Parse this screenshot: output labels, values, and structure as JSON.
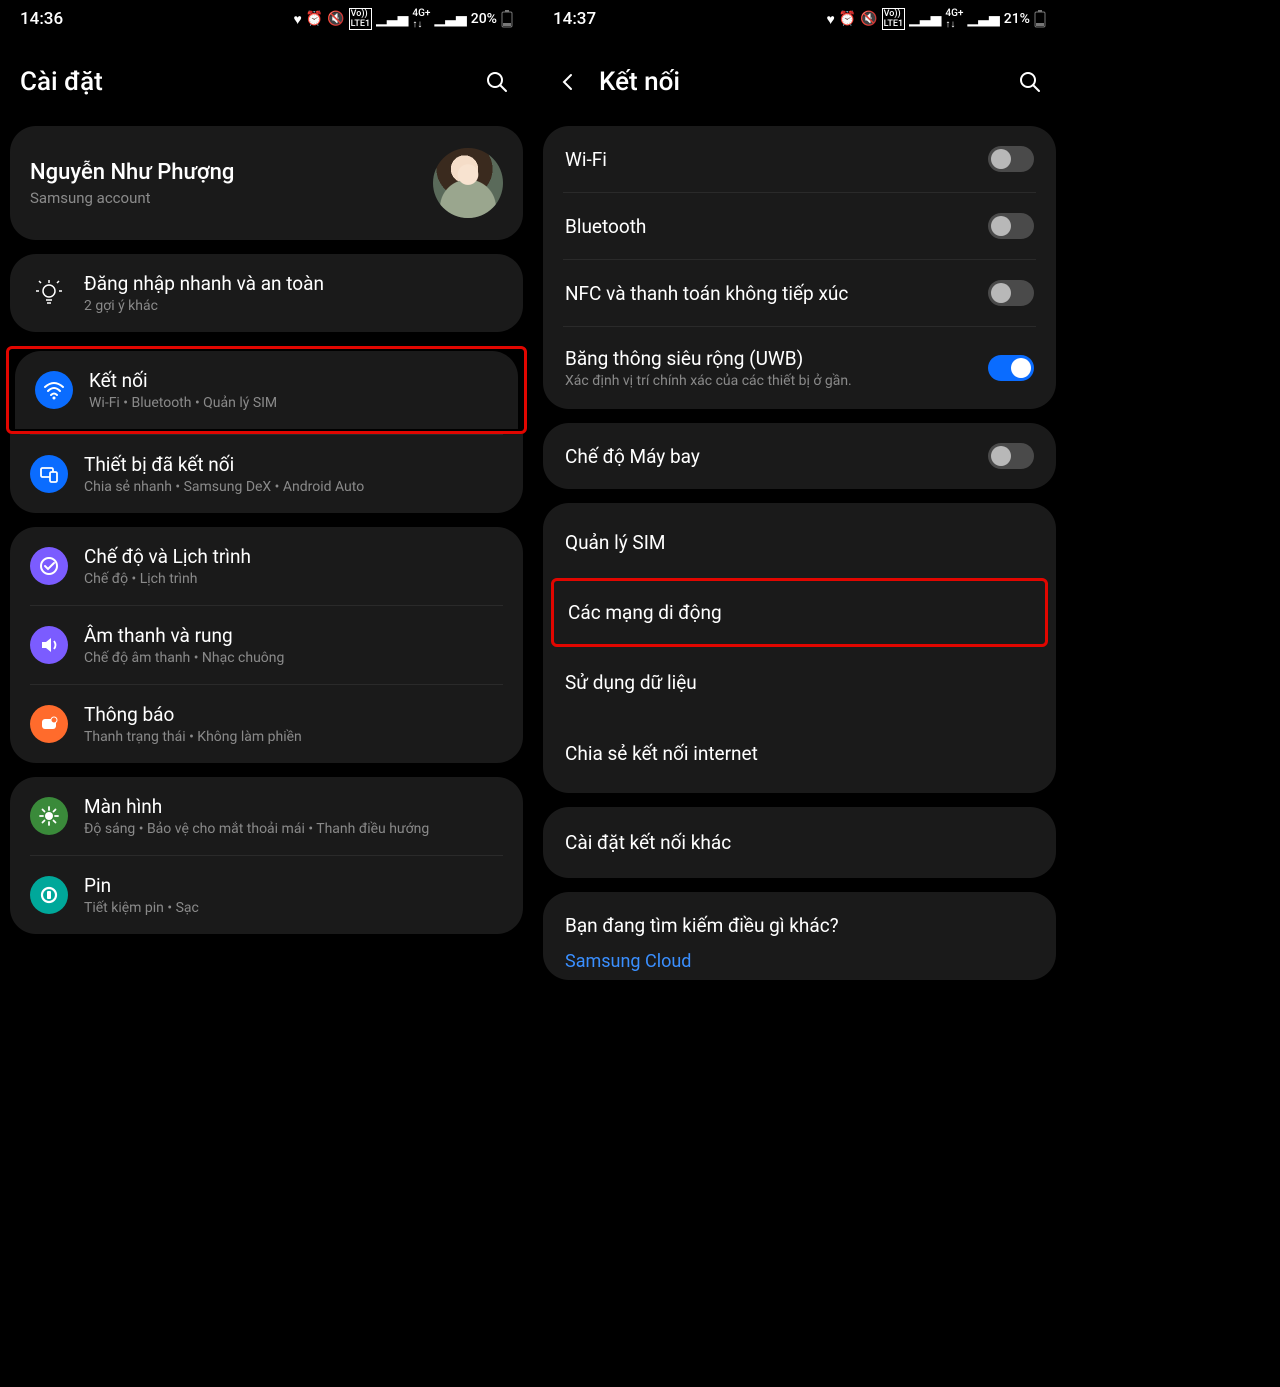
{
  "left": {
    "status": {
      "time": "14:36",
      "battery": "20%"
    },
    "title": "Cài đặt",
    "profile": {
      "name": "Nguyễn Như Phượng",
      "sub": "Samsung account"
    },
    "suggest": {
      "title": "Đăng nhập nhanh và an toàn",
      "sub": "2 gợi ý khác"
    },
    "group1": [
      {
        "title": "Kết nối",
        "sub": "Wi-Fi  •  Bluetooth  •  Quản lý SIM",
        "icon": "wifi",
        "highlight": true
      },
      {
        "title": "Thiết bị đã kết nối",
        "sub": "Chia sẻ nhanh  •  Samsung DeX  •  Android Auto",
        "icon": "devices"
      }
    ],
    "group2": [
      {
        "title": "Chế độ và Lịch trình",
        "sub": "Chế độ  •  Lịch trình",
        "icon": "modes"
      },
      {
        "title": "Âm thanh và rung",
        "sub": "Chế độ âm thanh  •  Nhạc chuông",
        "icon": "sound"
      },
      {
        "title": "Thông báo",
        "sub": "Thanh trạng thái  •  Không làm phiền",
        "icon": "notif"
      }
    ],
    "group3": [
      {
        "title": "Màn hình",
        "sub": "Độ sáng  •  Bảo vệ cho mắt thoải mái  •  Thanh điều hướng",
        "icon": "display"
      },
      {
        "title": "Pin",
        "sub": "Tiết kiệm pin  •  Sạc",
        "icon": "battery"
      }
    ]
  },
  "right": {
    "status": {
      "time": "14:37",
      "battery": "21%"
    },
    "title": "Kết nối",
    "toggles1": [
      {
        "label": "Wi-Fi",
        "on": false
      },
      {
        "label": "Bluetooth",
        "on": false
      },
      {
        "label": "NFC và thanh toán không tiếp xúc",
        "on": false
      },
      {
        "label": "Băng thông siêu rộng (UWB)",
        "sub": "Xác định vị trí chính xác của các thiết bị ở gần.",
        "on": true
      }
    ],
    "airplane": {
      "label": "Chế độ Máy bay",
      "on": false
    },
    "sim_group": [
      {
        "label": "Quản lý SIM"
      },
      {
        "label": "Các mạng di động",
        "highlight": true
      },
      {
        "label": "Sử dụng dữ liệu"
      },
      {
        "label": "Chia sẻ kết nối internet"
      }
    ],
    "other": {
      "label": "Cài đặt kết nối khác"
    },
    "search_more": {
      "q": "Bạn đang tìm kiếm điều gì khác?",
      "link": "Samsung Cloud"
    }
  }
}
